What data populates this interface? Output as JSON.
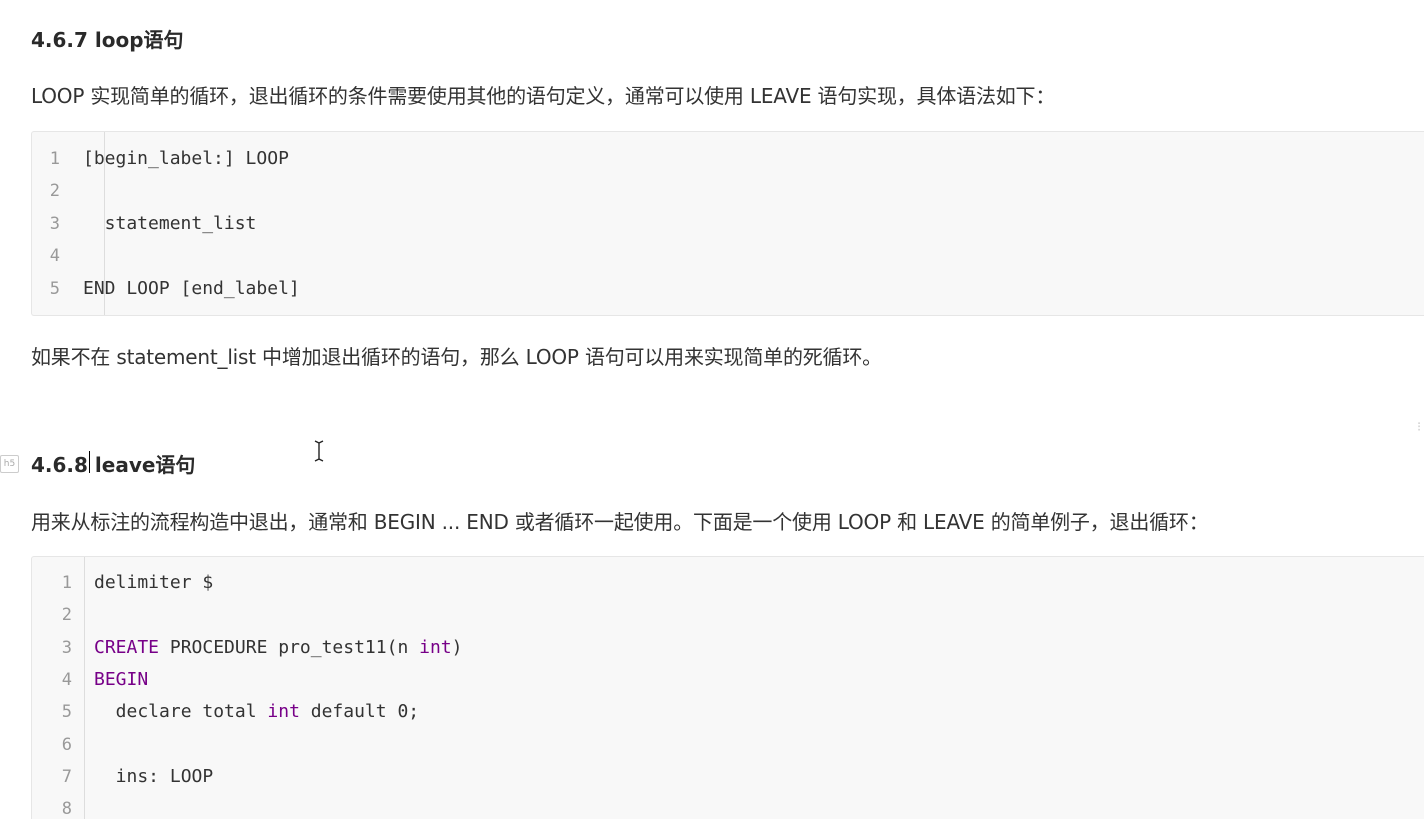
{
  "section1": {
    "heading": "4.6.7 loop语句",
    "description": "LOOP 实现简单的循环，退出循环的条件需要使用其他的语句定义，通常可以使用 LEAVE 语句实现，具体语法如下：",
    "code": [
      {
        "num": "1",
        "text": "[begin_label:] LOOP"
      },
      {
        "num": "2",
        "text": ""
      },
      {
        "num": "3",
        "text": "  statement_list"
      },
      {
        "num": "4",
        "text": ""
      },
      {
        "num": "5",
        "text": "END LOOP [end_label]"
      }
    ],
    "note": "如果不在 statement_list 中增加退出循环的语句，那么 LOOP 语句可以用来实现简单的死循环。"
  },
  "section2": {
    "marker": "h5",
    "heading": "4.6.8 leave语句",
    "description": "用来从标注的流程构造中退出，通常和 BEGIN ... END 或者循环一起使用。下面是一个使用 LOOP 和 LEAVE 的简单例子，退出循环：",
    "code": [
      {
        "num": "1",
        "parts": [
          {
            "t": "delimiter $",
            "c": ""
          }
        ]
      },
      {
        "num": "2",
        "parts": []
      },
      {
        "num": "3",
        "parts": [
          {
            "t": "CREATE",
            "c": "kw"
          },
          {
            "t": " PROCEDURE pro_test11(n ",
            "c": ""
          },
          {
            "t": "int",
            "c": "kw"
          },
          {
            "t": ")",
            "c": ""
          }
        ]
      },
      {
        "num": "4",
        "parts": [
          {
            "t": "BEGIN",
            "c": "kw"
          }
        ]
      },
      {
        "num": "5",
        "parts": [
          {
            "t": "  declare total ",
            "c": ""
          },
          {
            "t": "int",
            "c": "kw"
          },
          {
            "t": " default 0;",
            "c": ""
          }
        ]
      },
      {
        "num": "6",
        "parts": []
      },
      {
        "num": "7",
        "parts": [
          {
            "t": "  ins: LOOP",
            "c": ""
          }
        ]
      },
      {
        "num": "8",
        "parts": []
      }
    ]
  },
  "colors": {
    "keyword": "#770088",
    "text": "#333333",
    "code_background": "#f8f8f8",
    "line_number": "#999999"
  }
}
